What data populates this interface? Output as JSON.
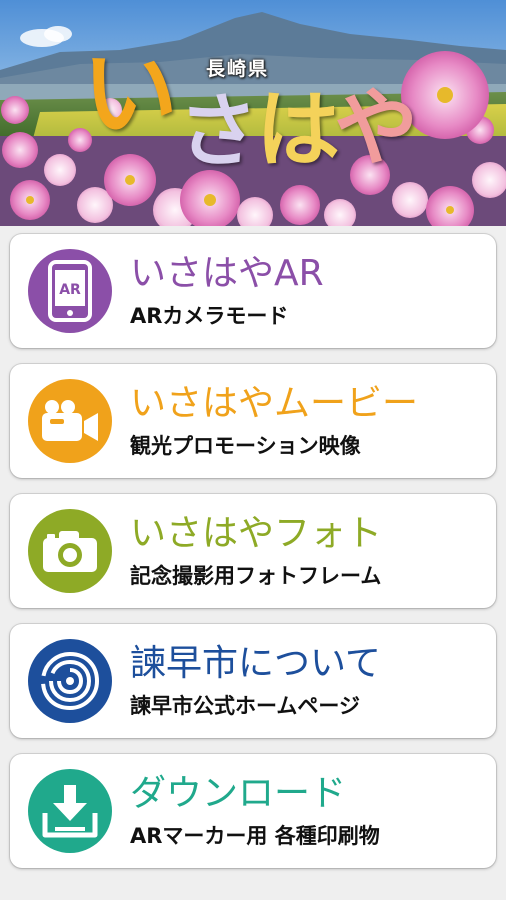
{
  "banner": {
    "prefecture": "長崎県",
    "logo_chars": [
      "い",
      "さ",
      "は",
      "や"
    ]
  },
  "menu": [
    {
      "title": "いさはやAR",
      "subtitle": "ARカメラモード",
      "color": "#8b4fa8",
      "icon": "ar-phone-icon",
      "icon_text": "AR"
    },
    {
      "title": "いさはやムービー",
      "subtitle": "観光プロモーション映像",
      "color": "#f0a21b",
      "icon": "video-camera-icon"
    },
    {
      "title": "いさはやフォト",
      "subtitle": "記念撮影用フォトフレーム",
      "color": "#8eaa26",
      "icon": "camera-icon"
    },
    {
      "title": "諫早市について",
      "subtitle": "諫早市公式ホームページ",
      "color": "#1d4f9c",
      "icon": "city-emblem-icon"
    },
    {
      "title": "ダウンロード",
      "subtitle": "ARマーカー用 各種印刷物",
      "color": "#20a98c",
      "icon": "download-icon"
    }
  ]
}
